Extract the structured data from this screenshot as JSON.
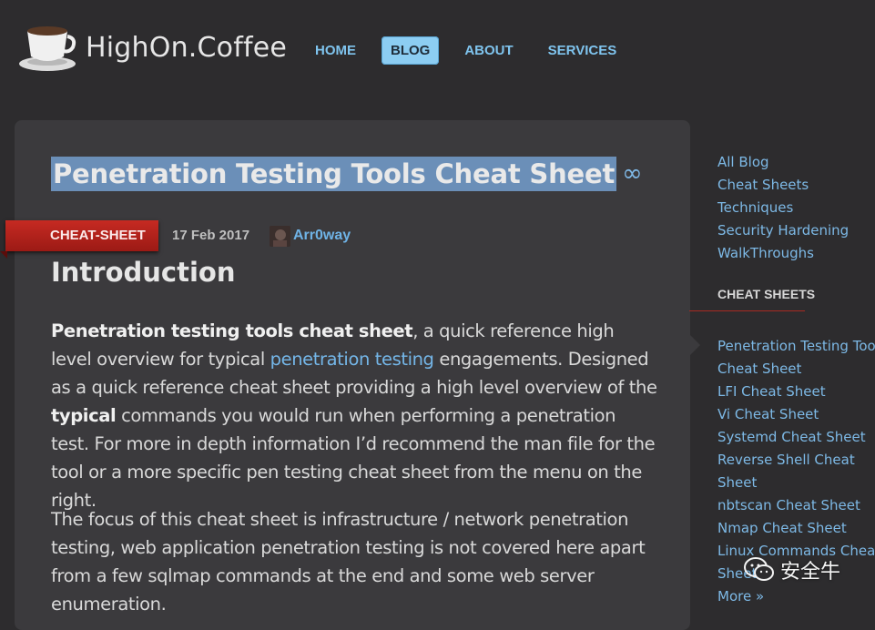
{
  "header": {
    "logo_text": "HighOn.Coffee",
    "nav": [
      {
        "label": "HOME",
        "active": false
      },
      {
        "label": "BLOG",
        "active": true
      },
      {
        "label": "ABOUT",
        "active": false
      },
      {
        "label": "SERVICES",
        "active": false
      }
    ]
  },
  "post": {
    "title": "Penetration Testing Tools Cheat Sheet",
    "permalink_symbol": "∞",
    "category": "CHEAT-SHEET",
    "date": "17 Feb 2017",
    "author": "Arr0way",
    "section_heading": "Introduction",
    "p1": {
      "strong_lead": "Penetration testing tools cheat sheet",
      "text_a": ", a quick reference high level overview for typical ",
      "link": "penetration testing",
      "text_b": " engagements. Designed as a quick reference cheat sheet providing a high level overview of the ",
      "strong_mid": "typical",
      "text_c": " commands you would run when performing a penetration test. For more in depth information I’d recommend the man file for the tool or a more specific pen testing cheat sheet from the menu on the right."
    },
    "p2": "The focus of this cheat sheet is infrastructure / network penetration testing, web application penetration testing is not covered here apart from a few sqlmap commands at the end and some web server enumeration."
  },
  "sidebar": {
    "links": [
      "All Blog",
      "Cheat Sheets",
      "Techniques",
      "Security Hardening",
      "WalkThroughs"
    ],
    "cheat_sheets_heading": "CHEAT SHEETS",
    "cheat_sheets": [
      "Penetration Testing Tools",
      "Cheat Sheet",
      "LFI Cheat Sheet",
      "Vi Cheat Sheet",
      "Systemd Cheat Sheet",
      "Reverse Shell Cheat",
      "Sheet",
      "nbtscan Cheat Sheet",
      "Nmap Cheat Sheet",
      "Linux Commands Cheat",
      "Sheet",
      "More »"
    ]
  },
  "watermark": {
    "text": "安全牛"
  },
  "colors": {
    "background": "#2d2c2e",
    "card": "#3b3a3d",
    "link": "#7db9e6",
    "ribbon": "#b8231c",
    "title_highlight": "#6b8fb8"
  }
}
